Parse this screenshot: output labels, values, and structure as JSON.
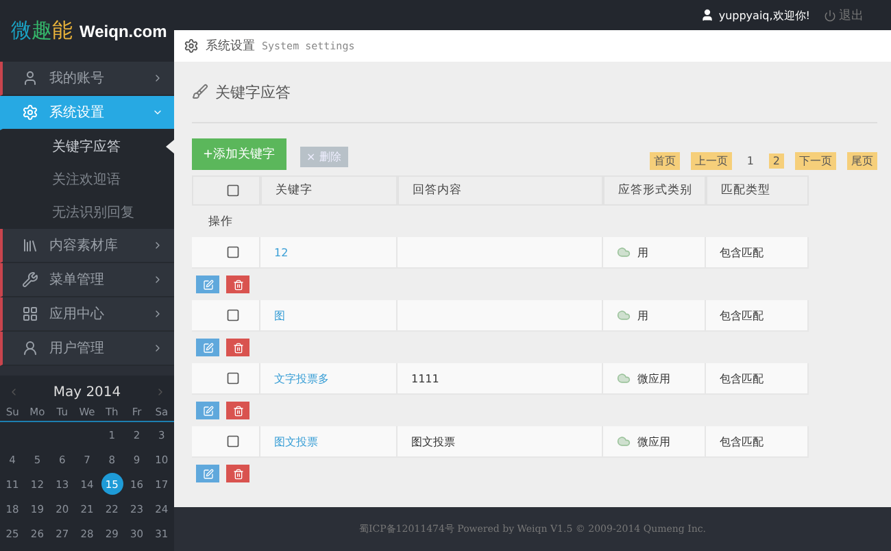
{
  "logo": {
    "mark": "微趣能",
    "site": "Weiqn.com"
  },
  "top_bar": {
    "user": "yuppyaiq,欢迎你!",
    "logout": "退出"
  },
  "sidebar": {
    "items": [
      {
        "label": "我的账号",
        "selected": false,
        "expanded": false
      },
      {
        "label": "系统设置",
        "selected": true,
        "expanded": true,
        "children": [
          {
            "label": "关键字应答",
            "selected": true
          },
          {
            "label": "关注欢迎语",
            "selected": false
          },
          {
            "label": "无法识别回复",
            "selected": false
          }
        ]
      },
      {
        "label": "内容素材库",
        "selected": false,
        "expanded": false
      },
      {
        "label": "菜单管理",
        "selected": false,
        "expanded": false
      },
      {
        "label": "应用中心",
        "selected": false,
        "expanded": false
      },
      {
        "label": "用户管理",
        "selected": false,
        "expanded": false
      }
    ]
  },
  "calendar": {
    "month": "May 2014",
    "weekdays": [
      "Su",
      "Mo",
      "Tu",
      "We",
      "Th",
      "Fr",
      "Sa"
    ],
    "weeks": [
      [
        {
          "day": "1",
          "selected": false
        },
        {
          "day": "2",
          "selected": false
        },
        {
          "day": "3",
          "selected": false
        }
      ],
      [
        {
          "day": "4",
          "selected": false
        },
        {
          "day": "5",
          "selected": false
        },
        {
          "day": "6",
          "selected": false
        },
        {
          "day": "7",
          "selected": false
        },
        {
          "day": "8",
          "selected": false
        },
        {
          "day": "9",
          "selected": false
        },
        {
          "day": "10",
          "selected": false
        }
      ],
      [
        {
          "day": "11",
          "selected": false
        },
        {
          "day": "12",
          "selected": false
        },
        {
          "day": "13",
          "selected": false
        },
        {
          "day": "14",
          "selected": false
        },
        {
          "day": "15",
          "selected": true
        },
        {
          "day": "16",
          "selected": false
        },
        {
          "day": "17",
          "selected": false
        }
      ],
      [
        {
          "day": "18",
          "selected": false
        },
        {
          "day": "19",
          "selected": false
        },
        {
          "day": "20",
          "selected": false
        },
        {
          "day": "21",
          "selected": false
        },
        {
          "day": "22",
          "selected": false
        },
        {
          "day": "23",
          "selected": false
        },
        {
          "day": "24",
          "selected": false
        }
      ],
      [
        {
          "day": "25",
          "selected": false
        },
        {
          "day": "26",
          "selected": false
        },
        {
          "day": "27",
          "selected": false
        },
        {
          "day": "28",
          "selected": false
        },
        {
          "day": "29",
          "selected": false
        },
        {
          "day": "30",
          "selected": false
        },
        {
          "day": "31",
          "selected": false
        }
      ]
    ]
  },
  "breadcrumb": {
    "title": "系统设置",
    "subtitle": "System settings"
  },
  "page_title": "关键字应答",
  "toolbar": {
    "add": "+添加关键字",
    "delete": "× 删除"
  },
  "pagination": [
    {
      "label": "首页",
      "selected": false
    },
    {
      "label": "上一页",
      "selected": false
    },
    {
      "label": "1",
      "selected": true
    },
    {
      "label": "2",
      "selected": false
    },
    {
      "label": "下一页",
      "selected": false
    },
    {
      "label": "尾页",
      "selected": false
    }
  ],
  "table": {
    "all_checked": false,
    "columns": [
      "关键字",
      "回答内容",
      "应答形式类别",
      "匹配类型"
    ],
    "actions_header": "操作",
    "rows": [
      {
        "checked": false,
        "keyword": "12",
        "reply_type": "用",
        "match": "包含匹配"
      },
      {
        "checked": false,
        "keyword": "图",
        "reply_type": "用",
        "match": "包含匹配"
      },
      {
        "checked": false,
        "keyword": "文字投票多",
        "content": "1111",
        "reply_type": "微应用",
        "match": "包含匹配"
      },
      {
        "checked": false,
        "keyword": "图文投票",
        "content": "图文投票",
        "reply_type": "微应用",
        "match": "包含匹配"
      }
    ]
  },
  "footer": "蜀ICP备12011474号 Powered by Weiqn V1.5 © 2009-2014 Qumeng Inc."
}
